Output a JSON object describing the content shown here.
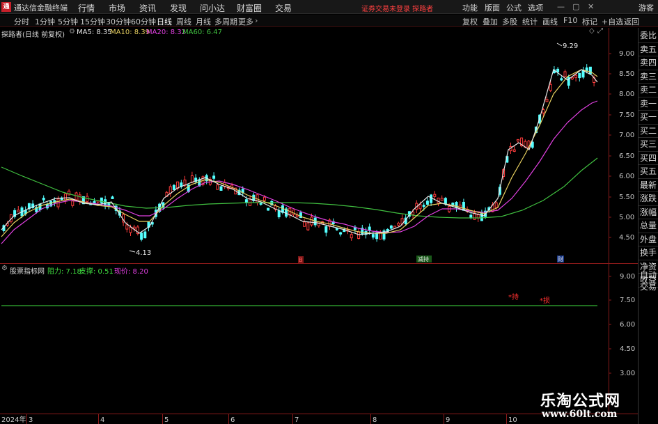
{
  "app": {
    "name": "通达信金融终端",
    "menus": [
      "行情",
      "市场",
      "资讯",
      "发现",
      "问小达",
      "财富圈",
      "交易"
    ],
    "notice": "证券交易未登录  探路者",
    "right_menus": [
      "功能",
      "版面",
      "公式",
      "选项"
    ],
    "guest": "游客"
  },
  "periods": {
    "items": [
      "分时",
      "1分钟",
      "5分钟",
      "15分钟",
      "30分钟",
      "60分钟",
      "日线",
      "周线",
      "月线",
      "多周期",
      "更多"
    ],
    "selected": "日线",
    "tools": [
      "复权",
      "叠加",
      "多股",
      "统计",
      "画线",
      "F10",
      "标记",
      "+自选",
      "返回"
    ]
  },
  "main_chart": {
    "title": "探路者(日线 前复权)",
    "ma": [
      {
        "label": "MA5: 8.35",
        "color": "#e8e8e8"
      },
      {
        "label": "MA10: 8.39",
        "color": "#e8d060"
      },
      {
        "label": "MA20: 8.32",
        "color": "#e040e0"
      },
      {
        "label": "MA60: 6.47",
        "color": "#40c040"
      }
    ],
    "price_axis": [
      "9.00",
      "8.50",
      "8.00",
      "7.50",
      "7.00",
      "6.50",
      "6.00",
      "5.50",
      "5.00",
      "4.50"
    ],
    "high_label": "9.29",
    "low_label": "4.13",
    "events": [
      {
        "label": "B"
      },
      {
        "label": "减持"
      },
      {
        "label": "财"
      }
    ]
  },
  "sub_chart": {
    "title": "股票指标网",
    "items": [
      {
        "label": "阻力: 7.18",
        "color": "#40e040"
      },
      {
        "label": "支撑: 0.51",
        "color": "#40e040"
      },
      {
        "label": "现价: 8.20",
        "color": "#e040e0"
      }
    ],
    "price_axis": [
      "9.00",
      "7.50",
      "6.00",
      "4.50",
      "3.00"
    ],
    "signals": [
      "*持",
      "*损"
    ]
  },
  "right_panel": {
    "items": [
      "委比",
      "卖五",
      "卖四",
      "卖三",
      "卖二",
      "卖一",
      "买一",
      "买二",
      "买三",
      "买四",
      "买五",
      "最新",
      "涨跌",
      "涨幅",
      "总量",
      "外盘",
      "换手",
      "净资",
      "收益"
    ],
    "auto": [
      "自动",
      "交易"
    ]
  },
  "time_axis": [
    "2024年",
    "3",
    "4",
    "5",
    "6",
    "7",
    "8",
    "9",
    "10"
  ],
  "watermark": {
    "line1": "乐淘公式网",
    "line2": "www.60lt.com"
  }
}
